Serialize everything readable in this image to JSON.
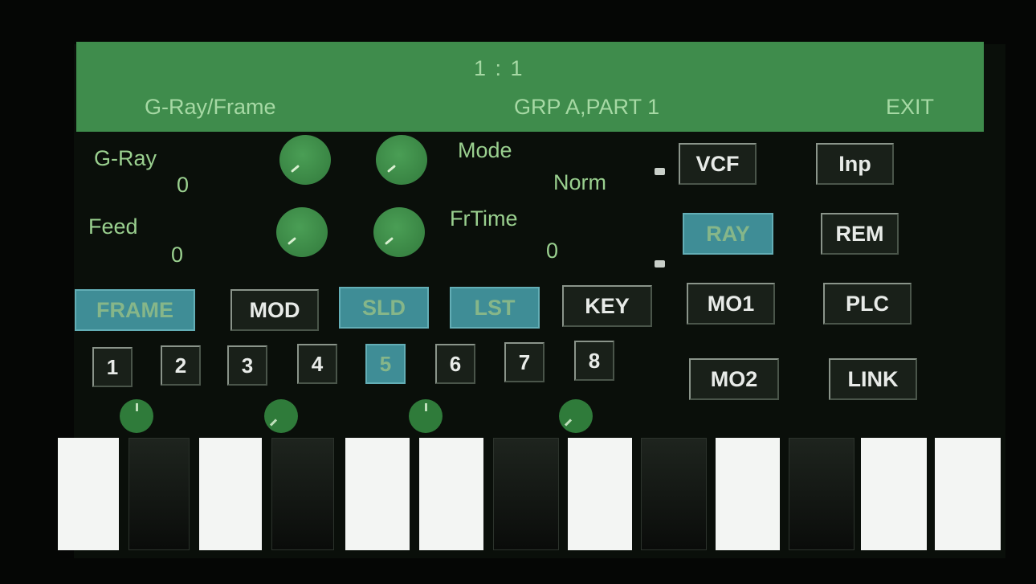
{
  "header": {
    "title": "1 : 1",
    "left_label": "G-Ray/Frame",
    "center_label": "GRP A,PART 1",
    "exit_label": "EXIT"
  },
  "params": {
    "gray": {
      "label": "G-Ray",
      "value": "0"
    },
    "feed": {
      "label": "Feed",
      "value": "0"
    },
    "mode": {
      "label": "Mode",
      "value": "Norm"
    },
    "frtime": {
      "label": "FrTime",
      "value": "0"
    }
  },
  "module_buttons": {
    "vcf": "VCF",
    "inp": "Inp",
    "ray": "RAY",
    "rem": "REM",
    "mo1": "MO1",
    "plc": "PLC",
    "mo2": "MO2",
    "link": "LINK"
  },
  "mode_buttons": {
    "frame": "FRAME",
    "mod": "MOD",
    "sld": "SLD",
    "lst": "LST",
    "key": "KEY"
  },
  "steps": [
    "1",
    "2",
    "3",
    "4",
    "5",
    "6",
    "7",
    "8"
  ],
  "active_step": "5",
  "colors": {
    "header_bg": "#3f8c4c",
    "active_button": "#3f8d96",
    "knob": "#3a8a45",
    "text": "#9ad08f"
  }
}
